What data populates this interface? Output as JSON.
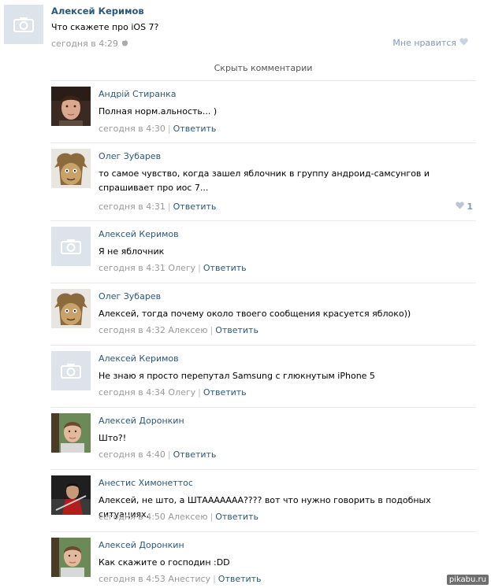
{
  "post": {
    "author": "Алексей Керимов",
    "text": "Что скажете про iOS 7?",
    "time": "сегодня в 4:29",
    "like_label": "Мне нравится"
  },
  "hide_comments_label": "Скрыть комментарии",
  "comments": [
    {
      "author": "Андрій Стиранка",
      "text": "Полная норм.альность... )",
      "time": "сегодня в 4:30",
      "reply_label": "Ответить"
    },
    {
      "author": "Олег Зубарев",
      "text": "то самое чувство, когда зашел яблочник в группу андроид-самсунгов и спрашивает про иос 7...",
      "time": "сегодня в 4:31",
      "reply_label": "Ответить",
      "likes": "1"
    },
    {
      "author": "Алексей Керимов",
      "text": "Я не яблочник",
      "time": "сегодня в 4:31 Олегу",
      "reply_label": "Ответить"
    },
    {
      "author": "Олег Зубарев",
      "text": "Алексей, тогда почему около твоего сообщения красуется яблоко))",
      "time": "сегодня в 4:32 Алексею",
      "reply_label": "Ответить"
    },
    {
      "author": "Алексей Керимов",
      "text": "Не знаю я просто перепутал Samsung с глюкнутым iPhone 5",
      "time": "сегодня в 4:34 Олегу",
      "reply_label": "Ответить"
    },
    {
      "author": "Алексей Доронкин",
      "text": "Што?!",
      "time": "сегодня в 4:40",
      "reply_label": "Ответить"
    },
    {
      "author": "Анестис Химонеттос",
      "text": "Алексей, не што, а ШТААААААА???? вот что нужно говорить в подобных ситуациях.",
      "time": "сегодня в 4:50 Алексею",
      "reply_label": "Ответить"
    },
    {
      "author": "Алексей Доронкин",
      "text": "Как скажите о господин :DD",
      "time": "сегодня в 4:53 Анестису",
      "reply_label": "Ответить"
    }
  ],
  "watermark": "pikabu.ru",
  "colors": {
    "link": "#2b587a",
    "meta": "#999999",
    "like": "#7d9ab7",
    "divider": "#e7ebf0"
  }
}
